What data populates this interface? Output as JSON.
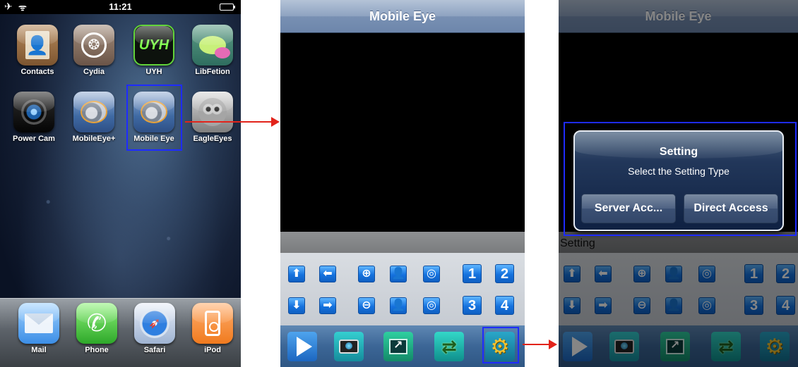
{
  "home": {
    "statusbar": {
      "airplane": "✈",
      "wifi": "ᯤ",
      "time": "11:21"
    },
    "apps": [
      {
        "label": "Contacts",
        "icon": "contacts-icon"
      },
      {
        "label": "Cydia",
        "icon": "cydia-icon"
      },
      {
        "label": "UYH",
        "icon": "uyh-icon"
      },
      {
        "label": "LibFetion",
        "icon": "libfetion-icon"
      },
      {
        "label": "Power Cam",
        "icon": "power-cam-icon"
      },
      {
        "label": "MobileEye+",
        "icon": "mobileeye-plus-icon"
      },
      {
        "label": "Mobile Eye",
        "icon": "mobile-eye-icon"
      },
      {
        "label": "EagleEyes",
        "icon": "eagleeyes-icon"
      }
    ],
    "dock": [
      {
        "label": "Mail",
        "icon": "mail-icon"
      },
      {
        "label": "Phone",
        "icon": "phone-icon"
      },
      {
        "label": "Safari",
        "icon": "safari-icon"
      },
      {
        "label": "iPod",
        "icon": "ipod-icon"
      }
    ],
    "glyphs": {
      "contacts": "👤",
      "cydia": "❂",
      "uyh": "UYH",
      "phone": "✆",
      "safari": "➶"
    }
  },
  "viewer": {
    "title": "Mobile Eye",
    "status_text": "Setting",
    "controls": {
      "row1": [
        "⬆",
        "⬅",
        "⊕",
        "👤",
        "◎",
        "1",
        "2"
      ],
      "row2": [
        "⬇",
        "➡",
        "⊖",
        "👤",
        "◎",
        "3",
        "4"
      ],
      "icons_row1": [
        "arrow-up-icon",
        "arrow-left-icon",
        "zoom-in-icon",
        "focus-near-icon",
        "iris-open-icon"
      ],
      "icons_row2": [
        "arrow-down-icon",
        "arrow-right-icon",
        "zoom-out-icon",
        "focus-far-icon",
        "iris-close-icon"
      ]
    },
    "toolbar": [
      "play-icon",
      "snapshot-icon",
      "record-icon",
      "switch-icon",
      "gear-icon"
    ],
    "gear_glyph": "⚙"
  },
  "dialog": {
    "title": "Setting",
    "message": "Select the Setting Type",
    "buttons": [
      "Server Acc...",
      "Direct Access"
    ]
  },
  "colors": {
    "highlight": "#1e2bff",
    "arrow": "#e2231a",
    "nav_bar": "#8ea3c1",
    "control_button": "#1572de"
  }
}
